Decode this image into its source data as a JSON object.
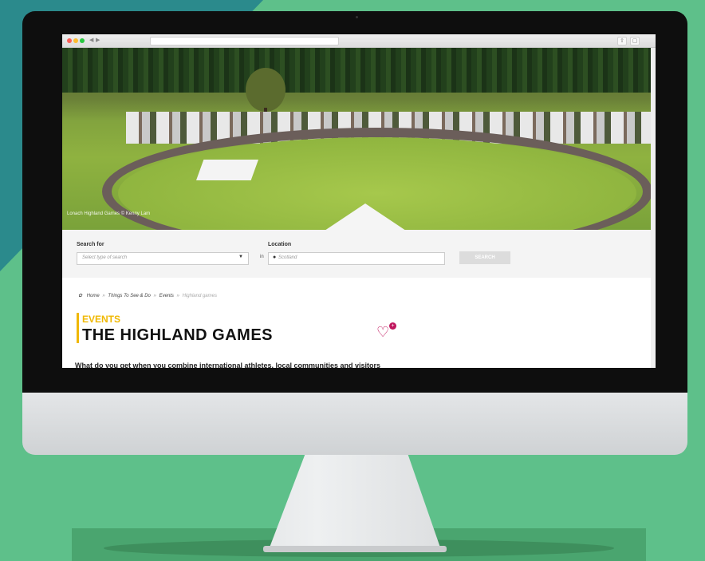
{
  "browser": {
    "url": ""
  },
  "hero": {
    "photo_credit": "Lonach Highland Games © Kenny Lam"
  },
  "search": {
    "search_for_label": "Search for",
    "search_for_placeholder": "Select type of search",
    "in_label": "in",
    "location_label": "Location",
    "location_value": "Scotland",
    "button_label": "SEARCH"
  },
  "breadcrumb": {
    "items": [
      "Home",
      "Things To See & Do",
      "Events",
      "Highland games"
    ],
    "separator": "»"
  },
  "page": {
    "eyebrow": "EVENTS",
    "title": "THE HIGHLAND GAMES",
    "intro": "What do you get when you combine international athletes, local communities and visitors"
  },
  "colors": {
    "accent": "#f0b800",
    "favourite": "#c0165e"
  },
  "icons": [
    "apple-logo-icon",
    "heart-plus-icon",
    "location-pin-icon",
    "chevron-down-icon",
    "thistle-home-icon"
  ]
}
